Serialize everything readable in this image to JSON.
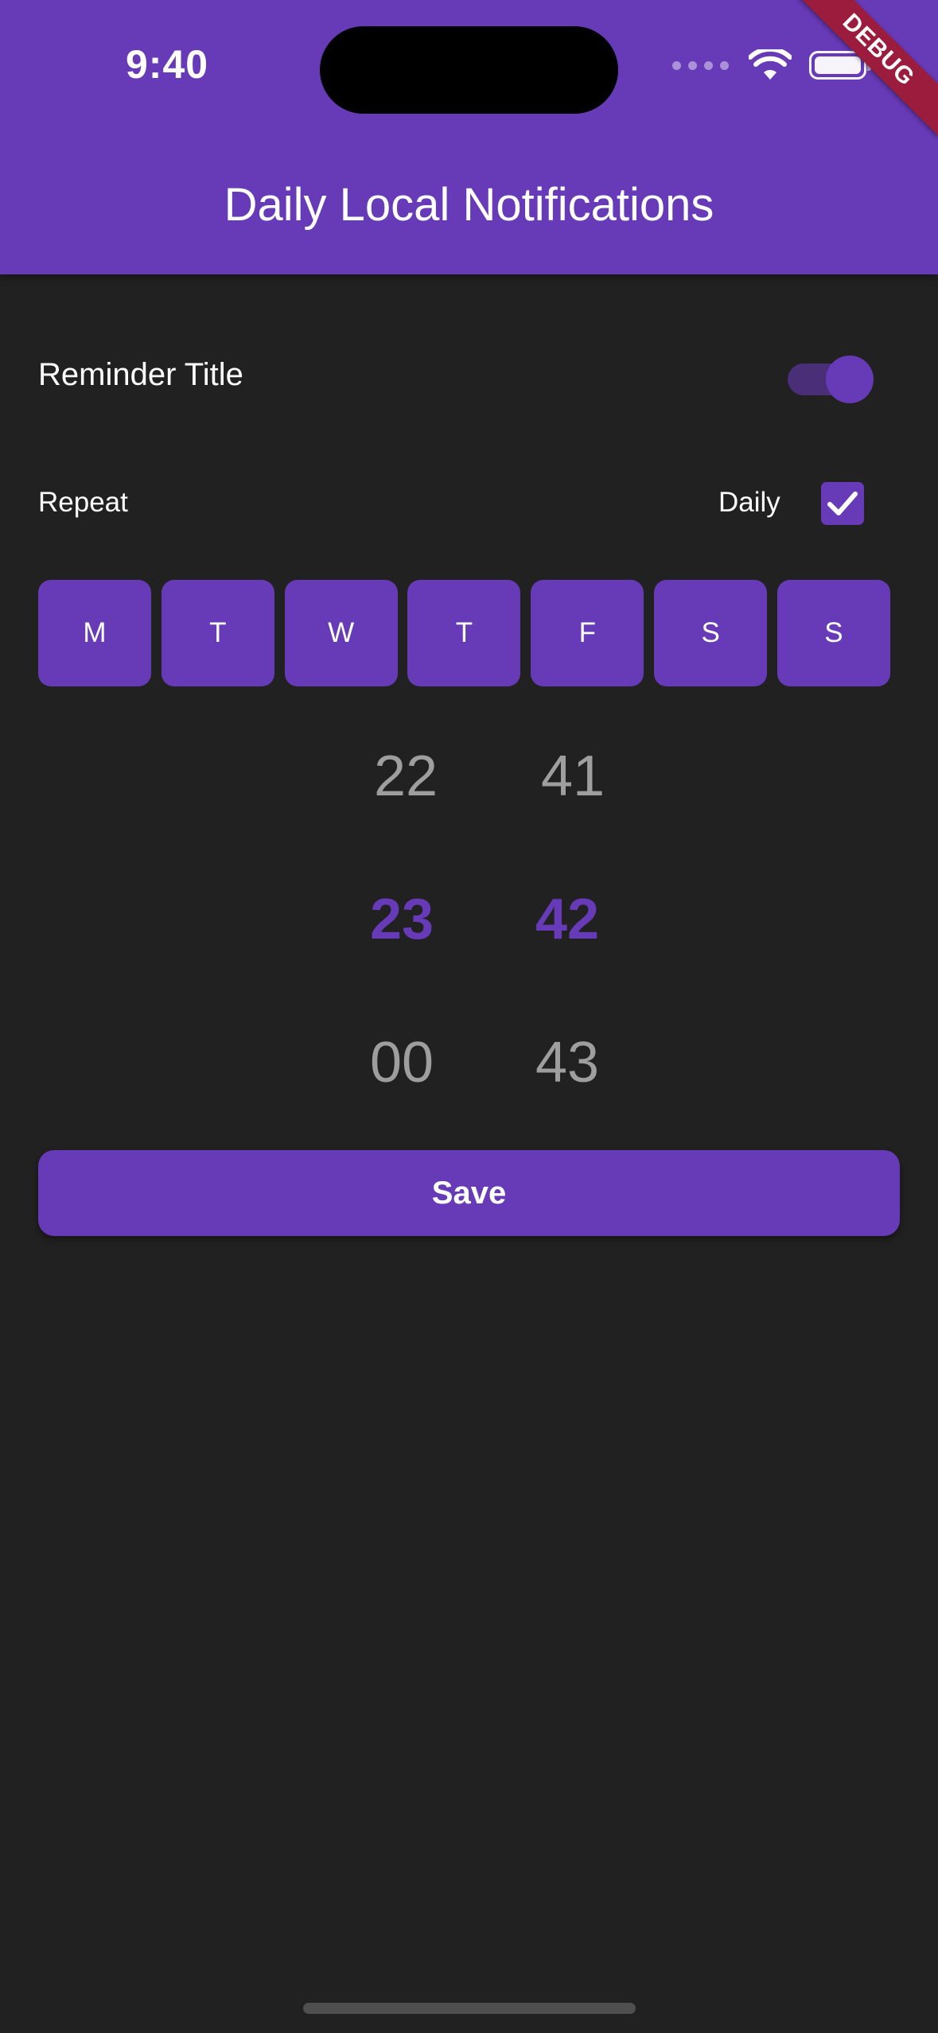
{
  "status_bar": {
    "time": "9:40"
  },
  "debug_banner": "DEBUG",
  "app_bar": {
    "title": "Daily Local Notifications"
  },
  "reminder": {
    "title": "Reminder Title",
    "enabled": true
  },
  "repeat": {
    "label": "Repeat",
    "daily_label": "Daily",
    "daily_checked": true
  },
  "days": [
    "M",
    "T",
    "W",
    "T",
    "F",
    "S",
    "S"
  ],
  "time_picker": {
    "hours": {
      "prev": "22",
      "selected": "23",
      "next": "00"
    },
    "minutes": {
      "prev": "41",
      "selected": "42",
      "next": "43"
    }
  },
  "save_label": "Save",
  "colors": {
    "primary": "#673AB7",
    "background": "#212121",
    "dim_text": "#9e9e9e",
    "debug": "#9b1c3c"
  }
}
